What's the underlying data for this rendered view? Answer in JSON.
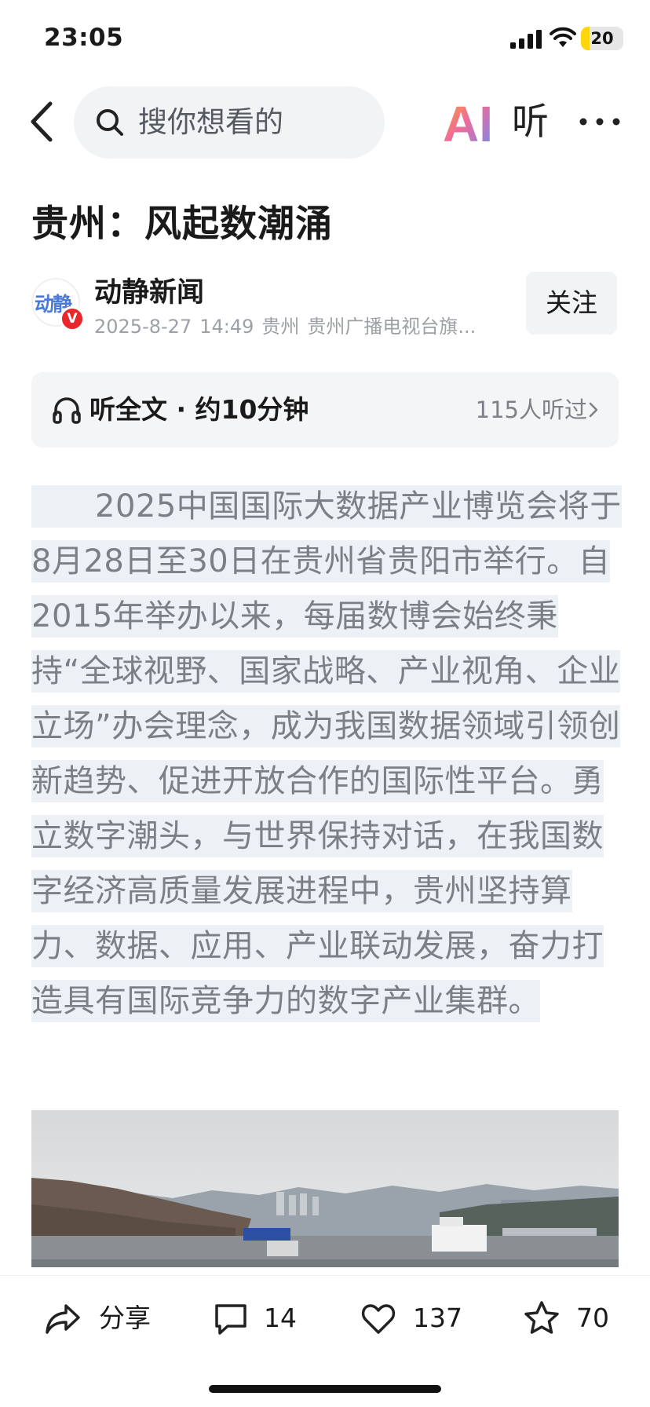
{
  "status_bar": {
    "time": "23:05",
    "battery_level": "20",
    "battery_fraction": 0.2
  },
  "nav": {
    "search_placeholder": "搜你想看的",
    "ai_label": "AI",
    "listen_label": "听",
    "icons": [
      "back-icon",
      "search-icon",
      "more-icon"
    ]
  },
  "article": {
    "title": "贵州：风起数潮涌",
    "author": {
      "name": "动静新闻",
      "avatar_text": "动静",
      "badge": "V",
      "date": "2025-8-27",
      "time": "14:49",
      "location": "贵州",
      "source": "贵州广播电视台旗..."
    },
    "follow_label": "关注",
    "listen": {
      "label": "听全文 · 约10分钟",
      "count": "115人听过"
    },
    "paragraph": "2025中国国际大数据产业博览会将于8月28日至30日在贵州省贵阳市举行。自2015年举办以来，每届数博会始终秉持“全球视野、国家战略、产业视角、企业立场”办会理念，成为我国数据领域引领创新趋势、促进开放合作的国际性平台。勇立数字潮头，与世界保持对话，在我国数字经济高质量发展进程中，贵州坚持算力、数据、应用、产业联动发展，奋力打造具有国际竞争力的数字产业集群。"
  },
  "toolbar": {
    "share_label": "分享",
    "comments": "14",
    "likes": "137",
    "favorites": "70"
  },
  "colors": {
    "highlight": "#edf0f4",
    "body_text": "#7b8087",
    "ai_gradient": [
      "#f06b9a",
      "#6b8bf5"
    ],
    "verified_red": "#e8262b",
    "battery": "#ffd60a"
  }
}
